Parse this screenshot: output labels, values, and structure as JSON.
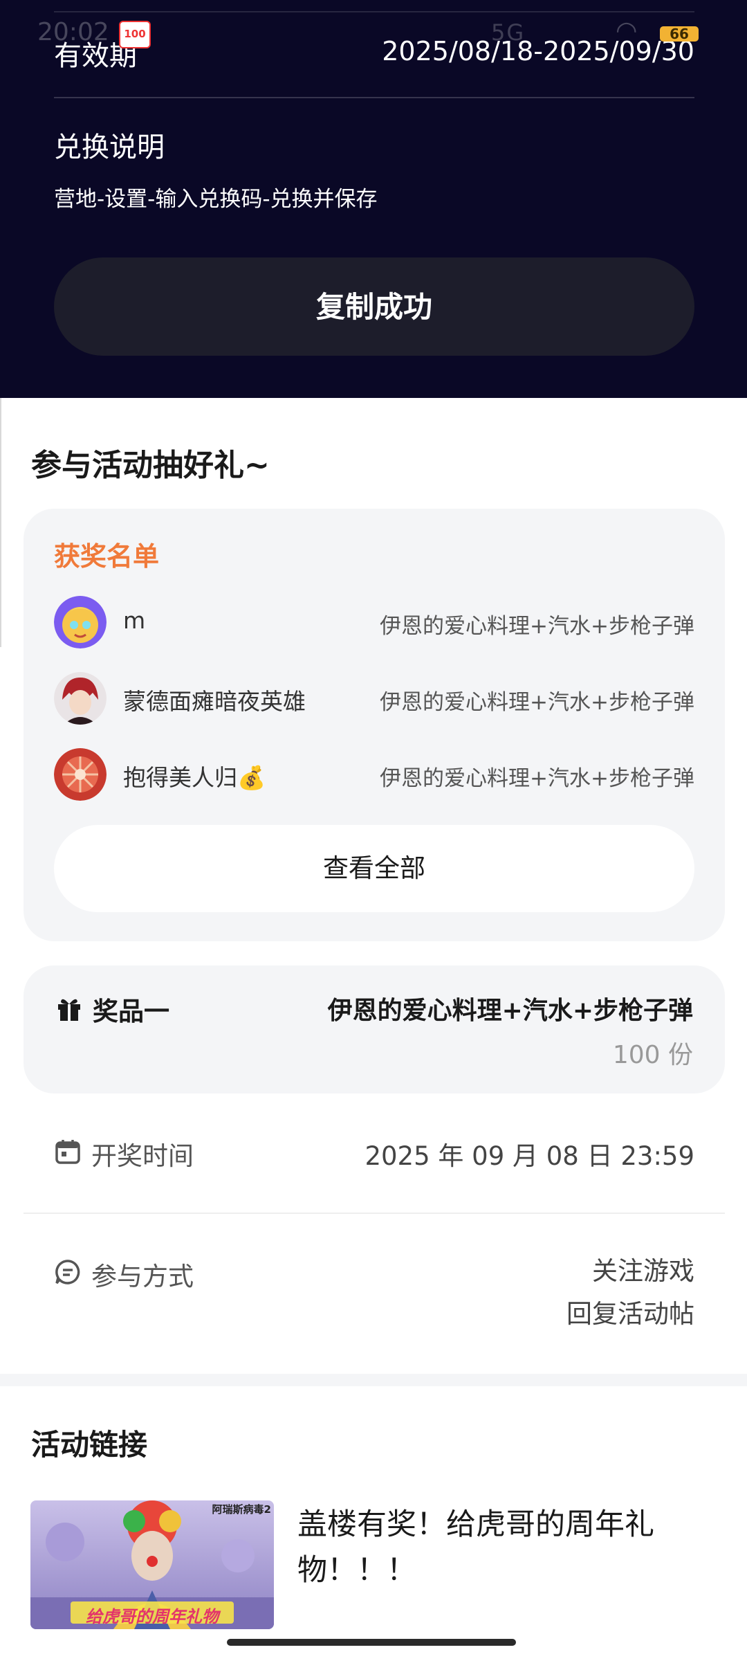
{
  "status_bar": {
    "time": "20:02",
    "app_badge": "100",
    "signal": "5G",
    "battery": "66"
  },
  "validity": {
    "label": "有效期",
    "value": "2025/08/18-2025/09/30"
  },
  "redeem": {
    "title": "兑换说明",
    "description": "营地-设置-输入兑换码-兑换并保存",
    "copy_button": "复制成功"
  },
  "activity": {
    "title": "参与活动抽好礼~",
    "winners_title": "获奖名单",
    "winners": [
      {
        "name": "m",
        "prize": "伊恩的爱心料理+汽水+步枪子弹"
      },
      {
        "name": "蒙德面瘫暗夜英雄",
        "prize": "伊恩的爱心料理+汽水+步枪子弹"
      },
      {
        "name": "抱得美人归💰",
        "prize": "伊恩的爱心料理+汽水+步枪子弹"
      }
    ],
    "view_all": "查看全部",
    "prize": {
      "label": "奖品一",
      "name": "伊恩的爱心料理+汽水+步枪子弹",
      "count": "100 份"
    },
    "draw_time": {
      "label": "开奖时间",
      "value": "2025 年 09 月 08 日 23:59"
    },
    "participation": {
      "label": "参与方式",
      "line1": "关注游戏",
      "line2": "回复活动帖"
    }
  },
  "links": {
    "title": "活动链接",
    "thumb_caption": "给虎哥的周年礼物",
    "thumb_corner": "阿瑞斯病毒2",
    "text": "盖楼有奖！给虎哥的周年礼物！！！"
  }
}
